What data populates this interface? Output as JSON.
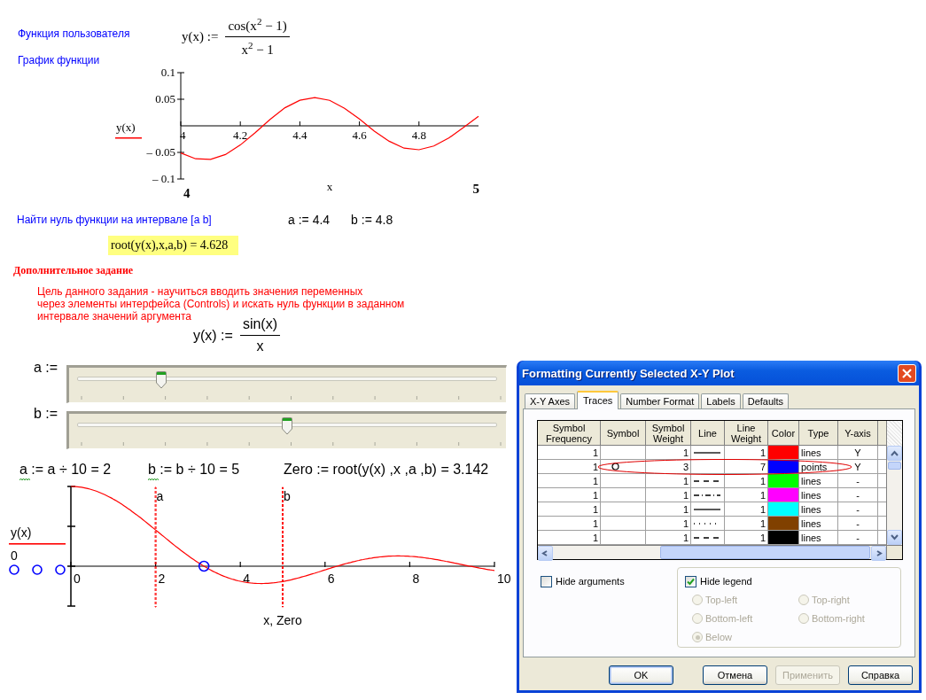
{
  "user_function": {
    "label": "Функция пользователя",
    "lhs": "y(x) :=",
    "numerator": "cos(x$^{2}$ − 1)",
    "denominator": "x$^{2}$ − 1"
  },
  "plot_heading": "График функции",
  "plot_1": {
    "x_range_labels": [
      "4",
      "5"
    ],
    "chart_data": {
      "type": "line",
      "xlabel": "x",
      "xlim": [
        4,
        5
      ],
      "ylim": [
        -0.1,
        0.1
      ],
      "x": [
        4,
        4.05,
        4.1,
        4.15,
        4.2,
        4.25,
        4.3,
        4.35,
        4.4,
        4.45,
        4.5,
        4.55,
        4.6,
        4.65,
        4.7,
        4.75,
        4.8,
        4.85,
        4.9,
        4.95,
        5
      ],
      "series": [
        {
          "name": "y(x)",
          "color": "#ff0000",
          "values": [
            -0.051,
            -0.062,
            -0.063,
            -0.054,
            -0.036,
            -0.013,
            0.012,
            0.034,
            0.048,
            0.053,
            0.048,
            0.033,
            0.013,
            -0.01,
            -0.029,
            -0.042,
            -0.045,
            -0.038,
            -0.023,
            -0.003,
            0.018
          ]
        }
      ],
      "xticks": [
        4,
        4.2,
        4.4,
        4.6,
        4.8
      ],
      "yticks": [
        {
          "value": 0.1,
          "label": "0.1"
        },
        {
          "value": 0.05,
          "label": "0.05"
        },
        {
          "value": -0.05,
          "label": "– 0.05"
        },
        {
          "value": -0.1,
          "label": "– 0.1"
        }
      ]
    }
  },
  "root_task": {
    "label": "Найти нуль функции на интервале [a b]",
    "definitions": [
      "a := 4.4",
      "b := 4.8"
    ],
    "result": "root(y(x),x,a,b) = 4.628"
  },
  "extra_task": {
    "heading": "Дополнительное задание",
    "description": "Цель данного задания - научиться вводить значения переменных\nчерез элементы интерфейса (Controls) и искать нуль функции в заданном\nинтервале значений аргумента",
    "function": {
      "lhs": "y(x) :=",
      "numerator": "sin(x)",
      "denominator": "x"
    }
  },
  "sliders": [
    {
      "label": "a :=",
      "level": 0.2
    },
    {
      "label": "b :=",
      "level": 0.5
    }
  ],
  "formulas": [
    {
      "text": "a := a ÷ 10 = 2",
      "flagged": true
    },
    {
      "text": "b := b ÷ 10 = 5",
      "flagged": true
    },
    {
      "text": "Zero := root(y(x) ,x ,a ,b) = 3.142",
      "flagged": false
    }
  ],
  "plot_2": {
    "legend": [
      {
        "label": "y(x)",
        "kind": "line",
        "color": "#ff0000"
      },
      {
        "label": "0",
        "kind": "circles",
        "color": "#0000ff"
      }
    ],
    "xtick_labels": [
      "0",
      "2",
      "4",
      "6",
      "8",
      "10"
    ],
    "markers": [
      "a",
      "b"
    ],
    "xlabel": "x, Zero"
  },
  "dialog": {
    "title": "Formatting Currently Selected X-Y Plot",
    "tabs": [
      {
        "label": "X-Y Axes",
        "selected": false
      },
      {
        "label": "Traces",
        "selected": true
      },
      {
        "label": "Number Format",
        "selected": false
      },
      {
        "label": "Labels",
        "selected": false
      },
      {
        "label": "Defaults",
        "selected": false
      }
    ],
    "table": {
      "columns": [
        "Symbol Frequency",
        "Symbol",
        "Symbol Weight",
        "Line",
        "Line Weight",
        "Color",
        "Type",
        "Y-axis"
      ],
      "rows": [
        {
          "symbol_frequency": "1",
          "symbol_weight": "1",
          "line": {
            "kind": "solid"
          },
          "line_weight": "1",
          "color": "#ff0000",
          "type": "lines",
          "y_axis": "Y",
          "circled": false
        },
        {
          "symbol_frequency": "1",
          "symbol": {
            "kind": "circle"
          },
          "symbol_weight": "3",
          "line_weight": "7",
          "color": "#0000ff",
          "type": "points",
          "y_axis": "Y",
          "circled": true
        },
        {
          "symbol_frequency": "1",
          "symbol_weight": "1",
          "line": {
            "kind": "dash"
          },
          "line_weight": "1",
          "color": "#00ff00",
          "type": "lines",
          "y_axis": "-",
          "circled": false
        },
        {
          "symbol_frequency": "1",
          "symbol_weight": "1",
          "line": {
            "kind": "dashdot"
          },
          "line_weight": "1",
          "color": "#ff00ff",
          "type": "lines",
          "y_axis": "-",
          "circled": false
        },
        {
          "symbol_frequency": "1",
          "symbol_weight": "1",
          "line": {
            "kind": "solid"
          },
          "line_weight": "1",
          "color": "#00ffff",
          "type": "lines",
          "y_axis": "-",
          "circled": false
        },
        {
          "symbol_frequency": "1",
          "symbol_weight": "1",
          "line": {
            "kind": "dot"
          },
          "line_weight": "1",
          "color": "#804000",
          "type": "lines",
          "y_axis": "-",
          "circled": false
        },
        {
          "symbol_frequency": "1",
          "symbol_weight": "1",
          "line": {
            "kind": "dash"
          },
          "line_weight": "1",
          "color": "#000000",
          "type": "lines",
          "y_axis": "-",
          "circled": false
        }
      ]
    },
    "options": [
      {
        "label": "Hide arguments",
        "checked": false
      }
    ],
    "legend_box": {
      "label": "Hide legend",
      "checked": true,
      "positions": [
        {
          "label": "Top-left",
          "selected": false
        },
        {
          "label": "Top-right",
          "selected": false
        },
        {
          "label": "Bottom-left",
          "selected": false
        },
        {
          "label": "Bottom-right",
          "selected": false
        },
        {
          "label": "Below",
          "selected": true
        }
      ]
    },
    "buttons": [
      {
        "label": "OK",
        "default": true,
        "disabled": false
      },
      {
        "label": "Отмена",
        "default": false,
        "disabled": false
      },
      {
        "label": "Применить",
        "default": false,
        "disabled": true
      },
      {
        "label": "Справка",
        "default": false,
        "disabled": false
      }
    ]
  }
}
